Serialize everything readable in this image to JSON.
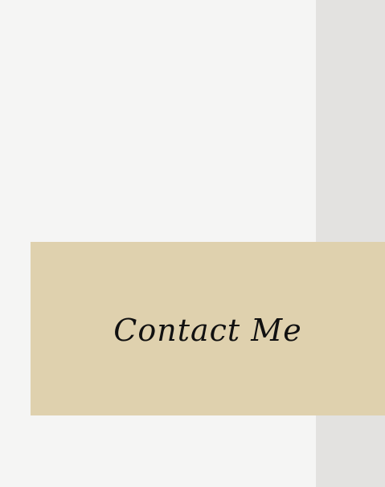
{
  "contact": {
    "label": "Contact Me"
  },
  "colors": {
    "page_background": "#f5f5f4",
    "side_panel": "#e3e2e0",
    "banner_background": "#dfd1ae",
    "banner_text": "#111111"
  }
}
